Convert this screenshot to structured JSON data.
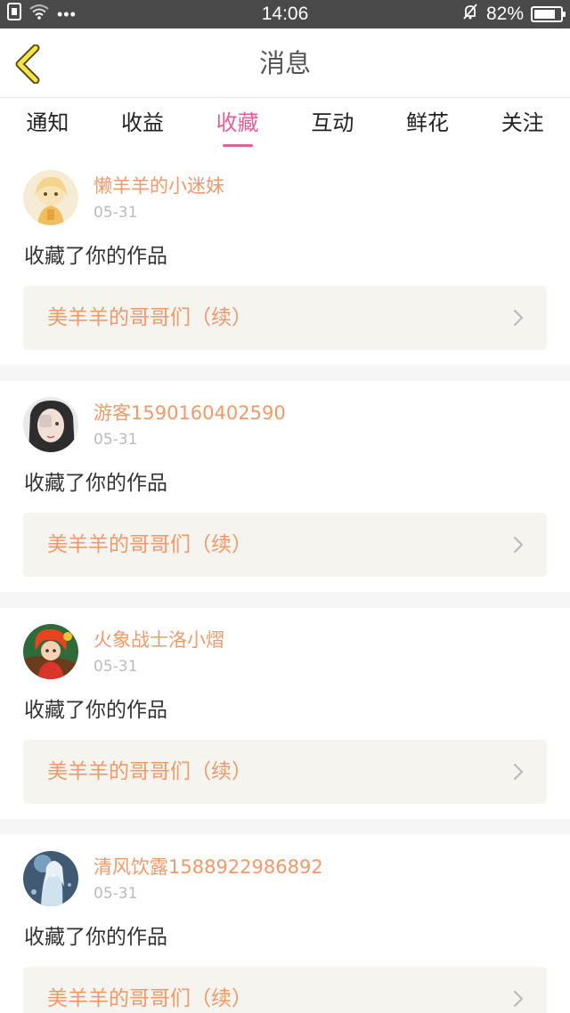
{
  "status_bar": {
    "time": "14:06",
    "battery": "82%",
    "battery_level": 0.82,
    "more_dots": "•••",
    "icons": [
      "sim-icon",
      "wifi-icon",
      "mute-bell-icon",
      "battery-icon"
    ]
  },
  "header": {
    "title": "消息",
    "back_icon": "chevron-left-icon"
  },
  "tabs": [
    {
      "label": "通知",
      "active": false
    },
    {
      "label": "收益",
      "active": false
    },
    {
      "label": "收藏",
      "active": true
    },
    {
      "label": "互动",
      "active": false
    },
    {
      "label": "鲜花",
      "active": false
    },
    {
      "label": "关注",
      "active": false
    }
  ],
  "colors": {
    "accent_pink": "#e0609a",
    "name_orange": "#f0996a",
    "work_bg": "#f5f4ee"
  },
  "messages": [
    {
      "user": "懒羊羊的小迷妹",
      "date": "05-31",
      "action": "收藏了你的作品",
      "work": "美羊羊的哥哥们（续）"
    },
    {
      "user": "游客1590160402590",
      "date": "05-31",
      "action": "收藏了你的作品",
      "work": "美羊羊的哥哥们（续）"
    },
    {
      "user": "火象战士洛小熠",
      "date": "05-31",
      "action": "收藏了你的作品",
      "work": "美羊羊的哥哥们（续）"
    },
    {
      "user": "清风饮露1588922986892",
      "date": "05-31",
      "action": "收藏了你的作品",
      "work": "美羊羊的哥哥们（续）"
    }
  ]
}
